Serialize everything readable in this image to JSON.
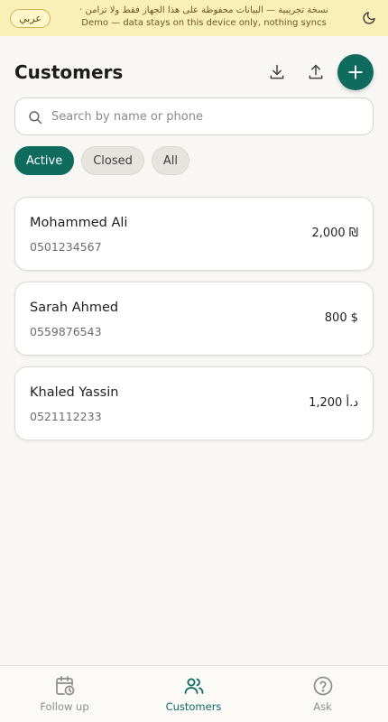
{
  "banner": {
    "language_label": "عربي",
    "line_ar": "نسخة تجريبية — البيانات محفوظة على هذا الجهاز فقط ولا تزامن ·",
    "line_en": "Demo — data stays on this device only, nothing syncs",
    "icon": "moon-icon"
  },
  "header": {
    "title": "Customers",
    "download_icon": "download-icon",
    "upload_icon": "upload-icon",
    "add_icon": "plus-icon"
  },
  "search": {
    "placeholder": "Search by name or phone",
    "value": ""
  },
  "filters": [
    {
      "label": "Active",
      "selected": true
    },
    {
      "label": "Closed",
      "selected": false
    },
    {
      "label": "All",
      "selected": false
    }
  ],
  "customers": [
    {
      "name": "Mohammed Ali",
      "phone": "0501234567",
      "amount": "2,000 ₪"
    },
    {
      "name": "Sarah Ahmed",
      "phone": "0559876543",
      "amount": "800 $"
    },
    {
      "name": "Khaled Yassin",
      "phone": "0521112233",
      "amount": "1,200 د.أ"
    }
  ],
  "tabs": [
    {
      "label": "Follow up",
      "icon": "calendar-clock-icon",
      "active": false
    },
    {
      "label": "Customers",
      "icon": "users-icon",
      "active": true
    },
    {
      "label": "Ask",
      "icon": "question-circle-icon",
      "active": false
    }
  ],
  "colors": {
    "accent": "#0e6b5e",
    "banner": "#fbefb8",
    "background": "#f8f7f3"
  }
}
